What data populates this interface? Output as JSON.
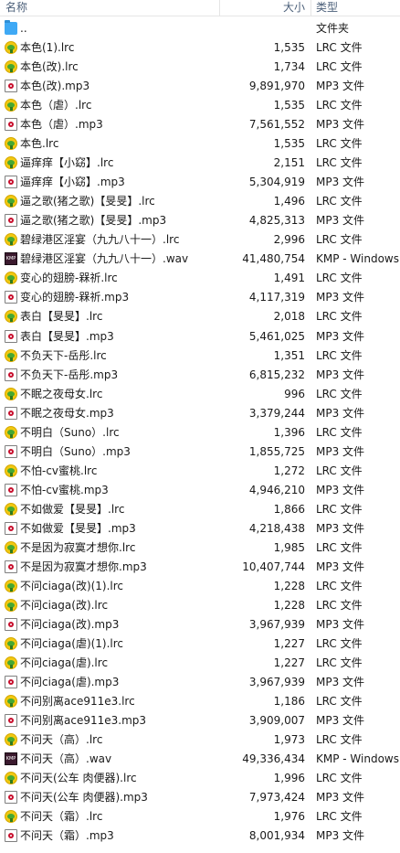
{
  "header": {
    "name": "名称",
    "size": "大小",
    "type": "类型"
  },
  "files": [
    {
      "name": "..",
      "size": "",
      "type": "文件夹",
      "icon": "folder-up-icon"
    },
    {
      "name": "本色(1).lrc",
      "size": "1,535",
      "type": "LRC 文件",
      "icon": "lrc-icon"
    },
    {
      "name": "本色(改).lrc",
      "size": "1,734",
      "type": "LRC 文件",
      "icon": "lrc-icon"
    },
    {
      "name": "本色(改).mp3",
      "size": "9,891,970",
      "type": "MP3 文件",
      "icon": "mp3-icon"
    },
    {
      "name": "本色（虐）.lrc",
      "size": "1,535",
      "type": "LRC 文件",
      "icon": "lrc-icon"
    },
    {
      "name": "本色（虐）.mp3",
      "size": "7,561,552",
      "type": "MP3 文件",
      "icon": "mp3-icon"
    },
    {
      "name": "本色.lrc",
      "size": "1,535",
      "type": "LRC 文件",
      "icon": "lrc-icon"
    },
    {
      "name": "逼痒痒【小窈】.lrc",
      "size": "2,151",
      "type": "LRC 文件",
      "icon": "lrc-icon"
    },
    {
      "name": "逼痒痒【小窈】.mp3",
      "size": "5,304,919",
      "type": "MP3 文件",
      "icon": "mp3-icon"
    },
    {
      "name": "逼之歌(猪之歌)【旻旻】.lrc",
      "size": "1,496",
      "type": "LRC 文件",
      "icon": "lrc-icon"
    },
    {
      "name": "逼之歌(猪之歌)【旻旻】.mp3",
      "size": "4,825,313",
      "type": "MP3 文件",
      "icon": "mp3-icon"
    },
    {
      "name": "碧绿港区淫宴（九九八十一）.lrc",
      "size": "2,996",
      "type": "LRC 文件",
      "icon": "lrc-icon"
    },
    {
      "name": "碧绿港区淫宴（九九八十一）.wav",
      "size": "41,480,754",
      "type": "KMP - Windows",
      "icon": "wav-icon"
    },
    {
      "name": "变心的翅膀-槑祈.lrc",
      "size": "1,491",
      "type": "LRC 文件",
      "icon": "lrc-icon"
    },
    {
      "name": "变心的翅膀-槑祈.mp3",
      "size": "4,117,319",
      "type": "MP3 文件",
      "icon": "mp3-icon"
    },
    {
      "name": "表白【旻旻】.lrc",
      "size": "2,018",
      "type": "LRC 文件",
      "icon": "lrc-icon"
    },
    {
      "name": "表白【旻旻】.mp3",
      "size": "5,461,025",
      "type": "MP3 文件",
      "icon": "mp3-icon"
    },
    {
      "name": "不负天下-岳彤.lrc",
      "size": "1,351",
      "type": "LRC 文件",
      "icon": "lrc-icon"
    },
    {
      "name": "不负天下-岳彤.mp3",
      "size": "6,815,232",
      "type": "MP3 文件",
      "icon": "mp3-icon"
    },
    {
      "name": "不眠之夜母女.lrc",
      "size": "996",
      "type": "LRC 文件",
      "icon": "lrc-icon"
    },
    {
      "name": "不眠之夜母女.mp3",
      "size": "3,379,244",
      "type": "MP3 文件",
      "icon": "mp3-icon"
    },
    {
      "name": "不明白（Suno）.lrc",
      "size": "1,396",
      "type": "LRC 文件",
      "icon": "lrc-icon"
    },
    {
      "name": "不明白（Suno）.mp3",
      "size": "1,855,725",
      "type": "MP3 文件",
      "icon": "mp3-icon"
    },
    {
      "name": "不怕-cv蜜桃.lrc",
      "size": "1,272",
      "type": "LRC 文件",
      "icon": "lrc-icon"
    },
    {
      "name": "不怕-cv蜜桃.mp3",
      "size": "4,946,210",
      "type": "MP3 文件",
      "icon": "mp3-icon"
    },
    {
      "name": "不如做爱【旻旻】.lrc",
      "size": "1,866",
      "type": "LRC 文件",
      "icon": "lrc-icon"
    },
    {
      "name": "不如做爱【旻旻】.mp3",
      "size": "4,218,438",
      "type": "MP3 文件",
      "icon": "mp3-icon"
    },
    {
      "name": "不是因为寂寞才想你.lrc",
      "size": "1,985",
      "type": "LRC 文件",
      "icon": "lrc-icon"
    },
    {
      "name": "不是因为寂寞才想你.mp3",
      "size": "10,407,744",
      "type": "MP3 文件",
      "icon": "mp3-icon"
    },
    {
      "name": "不问ciaga(改)(1).lrc",
      "size": "1,228",
      "type": "LRC 文件",
      "icon": "lrc-icon"
    },
    {
      "name": "不问ciaga(改).lrc",
      "size": "1,228",
      "type": "LRC 文件",
      "icon": "lrc-icon"
    },
    {
      "name": "不问ciaga(改).mp3",
      "size": "3,967,939",
      "type": "MP3 文件",
      "icon": "mp3-icon"
    },
    {
      "name": "不问ciaga(虐)(1).lrc",
      "size": "1,227",
      "type": "LRC 文件",
      "icon": "lrc-icon"
    },
    {
      "name": "不问ciaga(虐).lrc",
      "size": "1,227",
      "type": "LRC 文件",
      "icon": "lrc-icon"
    },
    {
      "name": "不问ciaga(虐).mp3",
      "size": "3,967,939",
      "type": "MP3 文件",
      "icon": "mp3-icon"
    },
    {
      "name": "不问别离ace911e3.lrc",
      "size": "1,186",
      "type": "LRC 文件",
      "icon": "lrc-icon"
    },
    {
      "name": "不问别离ace911e3.mp3",
      "size": "3,909,007",
      "type": "MP3 文件",
      "icon": "mp3-icon"
    },
    {
      "name": "不问天（高）.lrc",
      "size": "1,973",
      "type": "LRC 文件",
      "icon": "lrc-icon"
    },
    {
      "name": "不问天（高）.wav",
      "size": "49,336,434",
      "type": "KMP - Windows",
      "icon": "wav-icon"
    },
    {
      "name": "不问天(公车 肉便器).lrc",
      "size": "1,996",
      "type": "LRC 文件",
      "icon": "lrc-icon"
    },
    {
      "name": "不问天(公车 肉便器).mp3",
      "size": "7,973,424",
      "type": "MP3 文件",
      "icon": "mp3-icon"
    },
    {
      "name": "不问天（霜）.lrc",
      "size": "1,976",
      "type": "LRC 文件",
      "icon": "lrc-icon"
    },
    {
      "name": "不问天（霜）.mp3",
      "size": "8,001,934",
      "type": "MP3 文件",
      "icon": "mp3-icon"
    }
  ]
}
